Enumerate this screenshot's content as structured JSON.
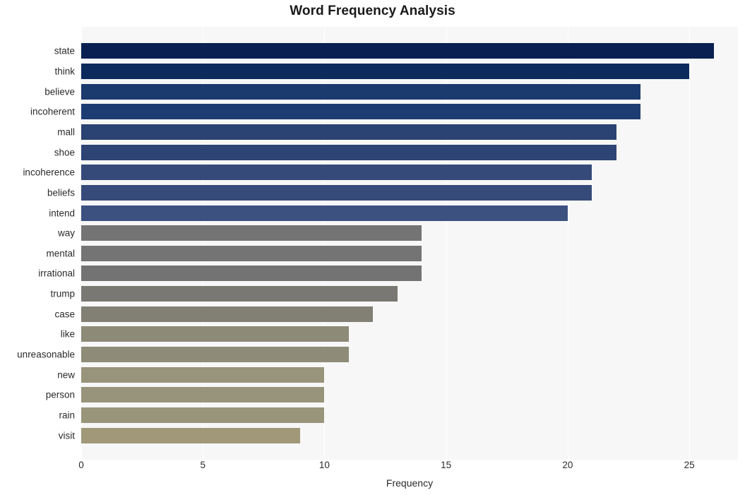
{
  "chart_data": {
    "type": "bar",
    "orientation": "horizontal",
    "title": "Word Frequency Analysis",
    "xlabel": "Frequency",
    "ylabel": "",
    "categories": [
      "state",
      "think",
      "believe",
      "incoherent",
      "mall",
      "shoe",
      "incoherence",
      "beliefs",
      "intend",
      "way",
      "mental",
      "irrational",
      "trump",
      "case",
      "like",
      "unreasonable",
      "new",
      "person",
      "rain",
      "visit"
    ],
    "values": [
      26,
      25,
      23,
      23,
      22,
      22,
      21,
      21,
      20,
      14,
      14,
      14,
      13,
      12,
      11,
      11,
      10,
      10,
      10,
      9
    ],
    "bar_colors": [
      "#0a2050",
      "#0c2a5c",
      "#1b3a6e",
      "#1d3c72",
      "#2b4372",
      "#2d4474",
      "#354a78",
      "#364b79",
      "#3d5180",
      "#747474",
      "#747474",
      "#737373",
      "#7a7873",
      "#827f74",
      "#8d8a77",
      "#8e8b78",
      "#98947b",
      "#98947b",
      "#99957b",
      "#a09878"
    ],
    "xlim": [
      0,
      27
    ],
    "xticks": [
      "0",
      "5",
      "10",
      "15",
      "20",
      "25"
    ],
    "xtick_values": [
      0,
      5,
      10,
      15,
      20,
      25
    ],
    "grid": true,
    "grid_axis": "x",
    "grid_color": "#ffffff",
    "plot_background": "#f7f7f7",
    "figure_background": "#ffffff",
    "legend": null
  }
}
